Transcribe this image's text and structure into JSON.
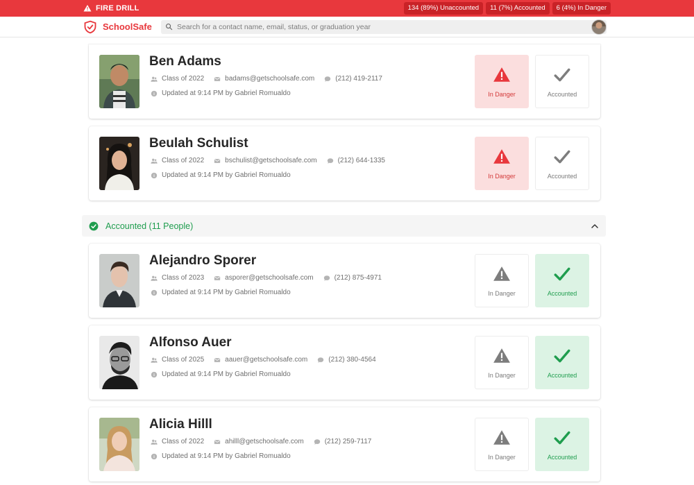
{
  "alert": {
    "title": "FIRE DRILL",
    "stats": [
      "134 (89%) Unaccounted",
      "11 (7%) Accounted",
      "6 (4%) In Danger"
    ]
  },
  "header": {
    "brand": "SchoolSafe",
    "search_placeholder": "Search for a contact name, email, status, or graduation year"
  },
  "section": {
    "title": "Accounted (11 People)"
  },
  "status_labels": {
    "danger": "In Danger",
    "accounted": "Accounted"
  },
  "colors": {
    "danger": "#e8383d",
    "accounted": "#1f9d4e",
    "danger_bg": "#fbdede",
    "accounted_bg": "#dcf3e4"
  },
  "people": [
    {
      "name": "Ben Adams",
      "class": "Class of 2022",
      "email": "badams@getschoolsafe.com",
      "phone": "(212) 419-2117",
      "updated": "Updated at 9:14 PM by Gabriel Romualdo",
      "status": "danger"
    },
    {
      "name": "Beulah Schulist",
      "class": "Class of 2022",
      "email": "bschulist@getschoolsafe.com",
      "phone": "(212) 644-1335",
      "updated": "Updated at 9:14 PM by Gabriel Romualdo",
      "status": "danger"
    },
    {
      "name": "Alejandro Sporer",
      "class": "Class of 2023",
      "email": "asporer@getschoolsafe.com",
      "phone": "(212) 875-4971",
      "updated": "Updated at 9:14 PM by Gabriel Romualdo",
      "status": "accounted"
    },
    {
      "name": "Alfonso Auer",
      "class": "Class of 2025",
      "email": "aauer@getschoolsafe.com",
      "phone": "(212) 380-4564",
      "updated": "Updated at 9:14 PM by Gabriel Romualdo",
      "status": "accounted"
    },
    {
      "name": "Alicia Hilll",
      "class": "Class of 2022",
      "email": "ahilll@getschoolsafe.com",
      "phone": "(212) 259-7117",
      "updated": "Updated at 9:14 PM by Gabriel Romualdo",
      "status": "accounted"
    }
  ]
}
